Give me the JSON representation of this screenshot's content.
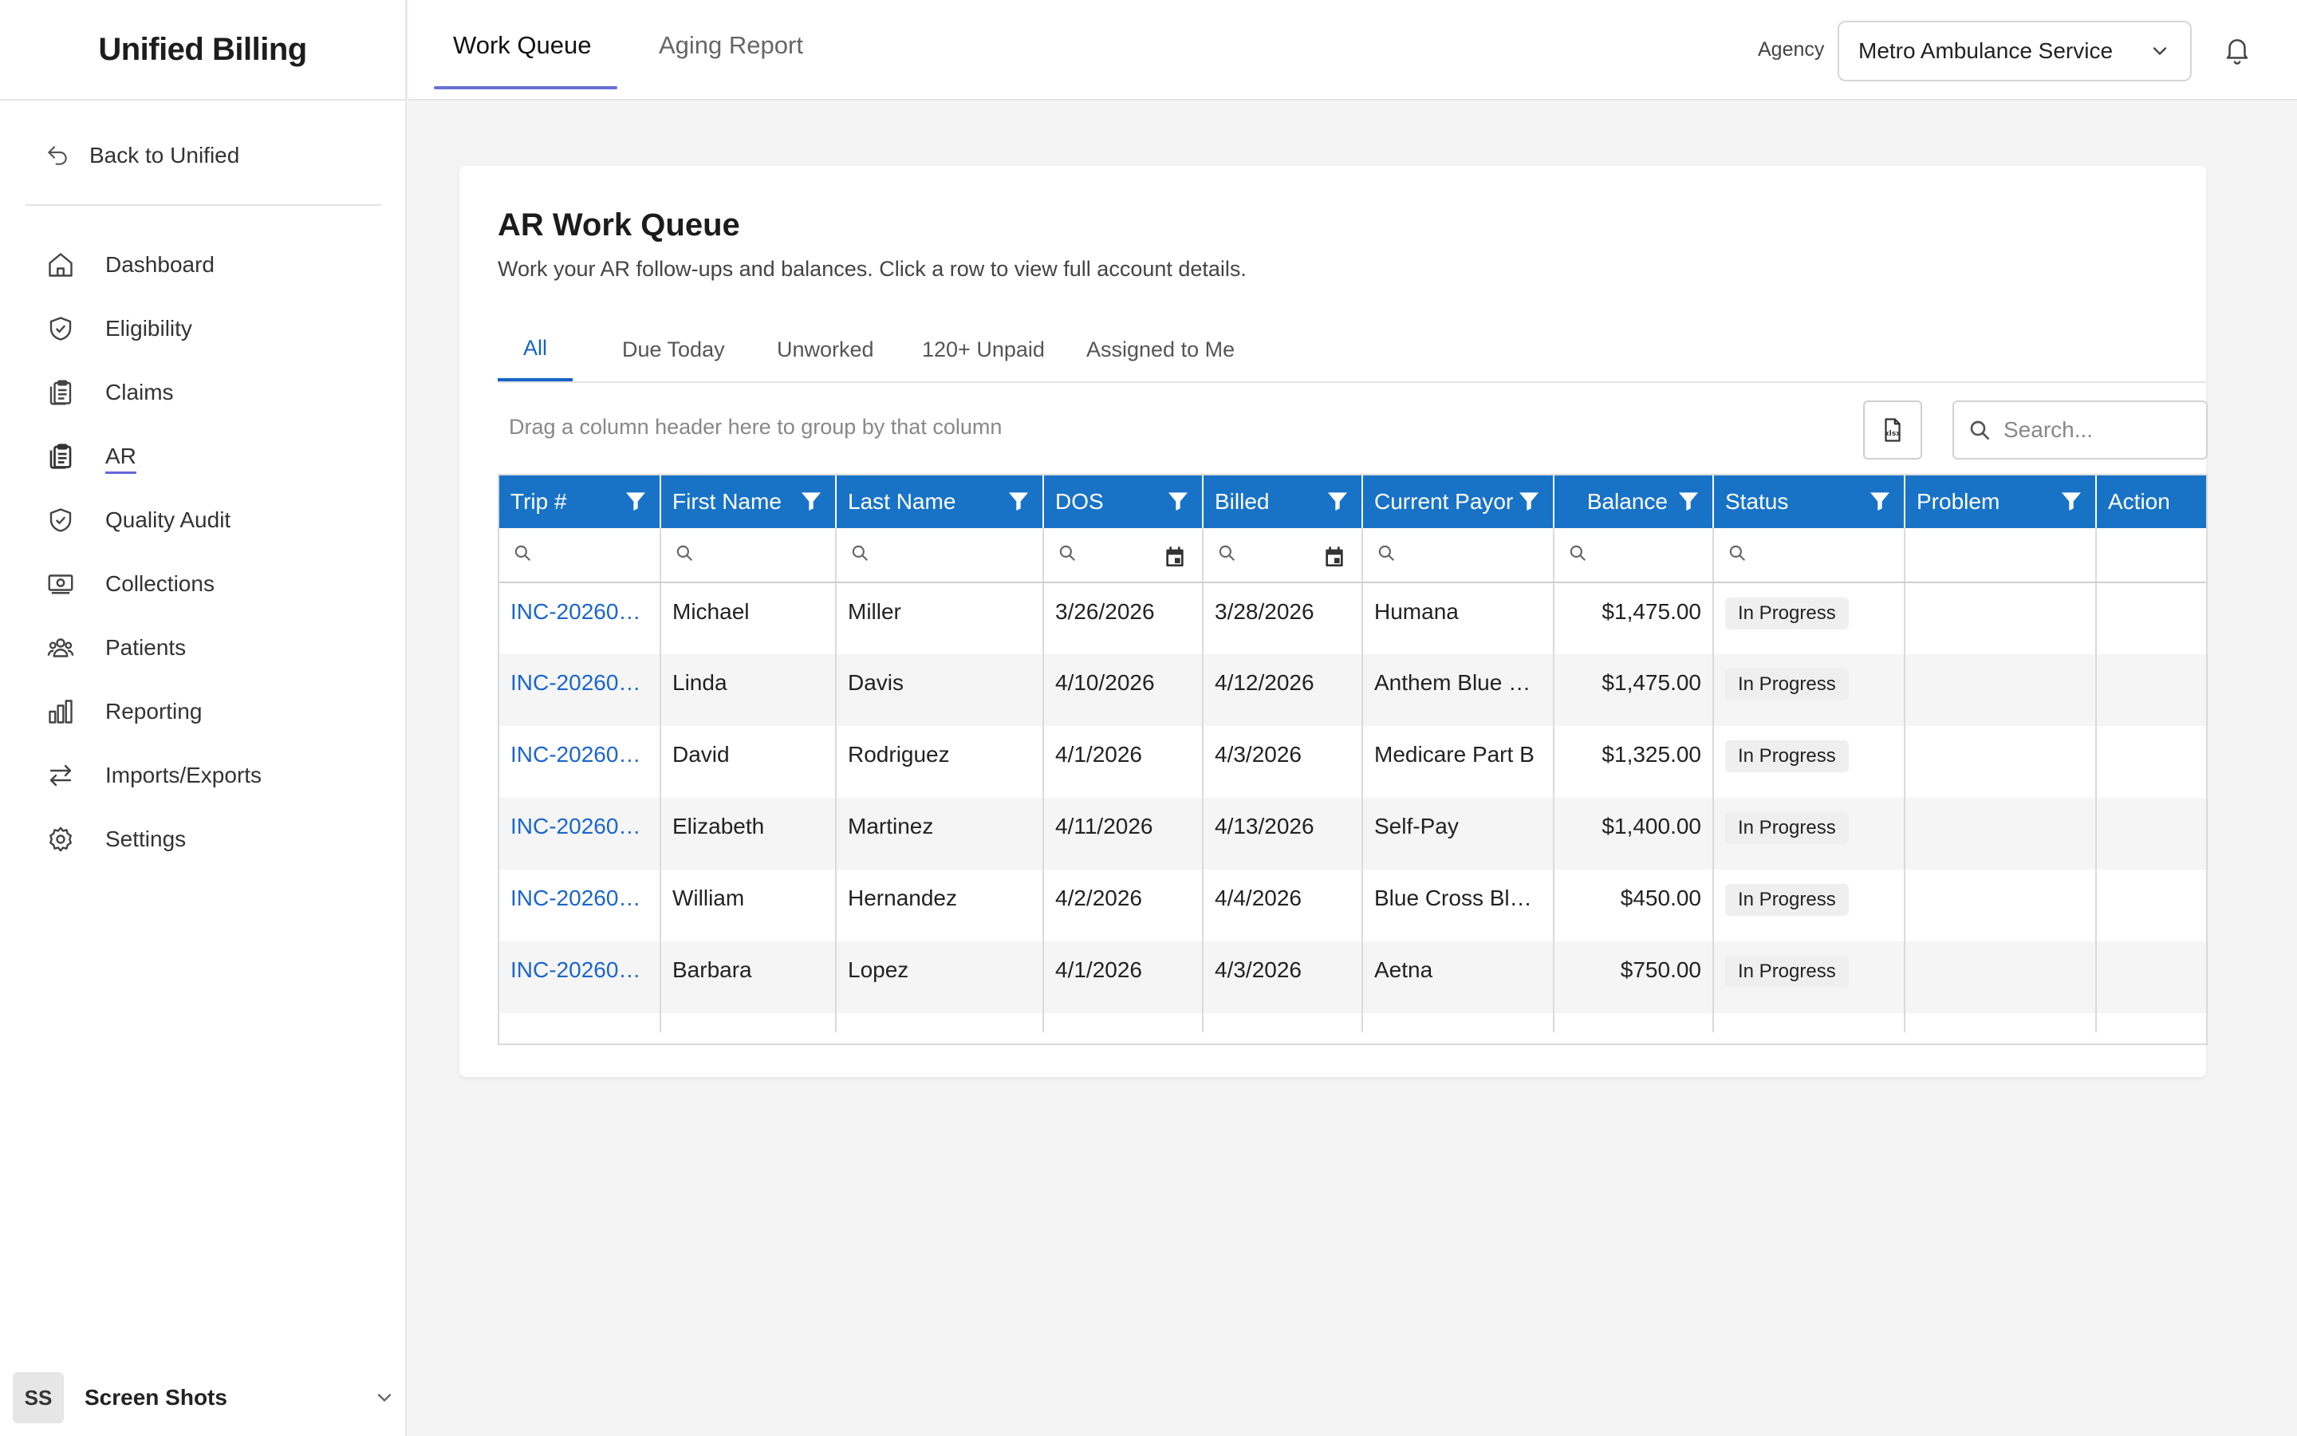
{
  "app": {
    "title": "Unified Billing"
  },
  "sidebar": {
    "back_label": "Back to Unified",
    "items": [
      {
        "label": "Dashboard",
        "icon": "home-icon"
      },
      {
        "label": "Eligibility",
        "icon": "shield-check-icon"
      },
      {
        "label": "Claims",
        "icon": "clipboard-icon"
      },
      {
        "label": "AR",
        "icon": "clipboard-stack-icon",
        "active": true
      },
      {
        "label": "Quality Audit",
        "icon": "shield-check-icon"
      },
      {
        "label": "Collections",
        "icon": "money-icon"
      },
      {
        "label": "Patients",
        "icon": "users-icon"
      },
      {
        "label": "Reporting",
        "icon": "bar-chart-icon"
      },
      {
        "label": "Imports/Exports",
        "icon": "arrows-swap-icon"
      },
      {
        "label": "Settings",
        "icon": "gear-icon"
      }
    ],
    "user": {
      "initials": "SS",
      "name": "Screen Shots"
    }
  },
  "topbar": {
    "tabs": [
      {
        "label": "Work Queue",
        "active": true
      },
      {
        "label": "Aging Report",
        "active": false
      }
    ],
    "agency_label": "Agency",
    "agency_value": "Metro Ambulance Service"
  },
  "card": {
    "title": "AR Work Queue",
    "subtitle": "Work your AR follow-ups and balances. Click a row to view full account details.",
    "tabs": [
      "All",
      "Due Today",
      "Unworked",
      "120+ Unpaid",
      "Assigned to Me"
    ],
    "group_hint": "Drag a column header here to group by that column",
    "search_placeholder": "Search..."
  },
  "grid": {
    "columns": [
      "Trip #",
      "First Name",
      "Last Name",
      "DOS",
      "Billed",
      "Current Payor",
      "Balance",
      "Status",
      "Problem",
      "Action"
    ],
    "rows": [
      {
        "trip": "INC-20260…",
        "first": "Michael",
        "last": "Miller",
        "dos": "3/26/2026",
        "billed": "3/28/2026",
        "payor": "Humana",
        "balance": "$1,475.00",
        "status": "In Progress"
      },
      {
        "trip": "INC-20260…",
        "first": "Linda",
        "last": "Davis",
        "dos": "4/10/2026",
        "billed": "4/12/2026",
        "payor": "Anthem Blue …",
        "balance": "$1,475.00",
        "status": "In Progress"
      },
      {
        "trip": "INC-20260…",
        "first": "David",
        "last": "Rodriguez",
        "dos": "4/1/2026",
        "billed": "4/3/2026",
        "payor": "Medicare Part B",
        "balance": "$1,325.00",
        "status": "In Progress"
      },
      {
        "trip": "INC-20260…",
        "first": "Elizabeth",
        "last": "Martinez",
        "dos": "4/11/2026",
        "billed": "4/13/2026",
        "payor": "Self-Pay",
        "balance": "$1,400.00",
        "status": "In Progress"
      },
      {
        "trip": "INC-20260…",
        "first": "William",
        "last": "Hernandez",
        "dos": "4/2/2026",
        "billed": "4/4/2026",
        "payor": "Blue Cross Bl…",
        "balance": "$450.00",
        "status": "In Progress"
      },
      {
        "trip": "INC-20260…",
        "first": "Barbara",
        "last": "Lopez",
        "dos": "4/1/2026",
        "billed": "4/3/2026",
        "payor": "Aetna",
        "balance": "$750.00",
        "status": "In Progress"
      }
    ]
  }
}
